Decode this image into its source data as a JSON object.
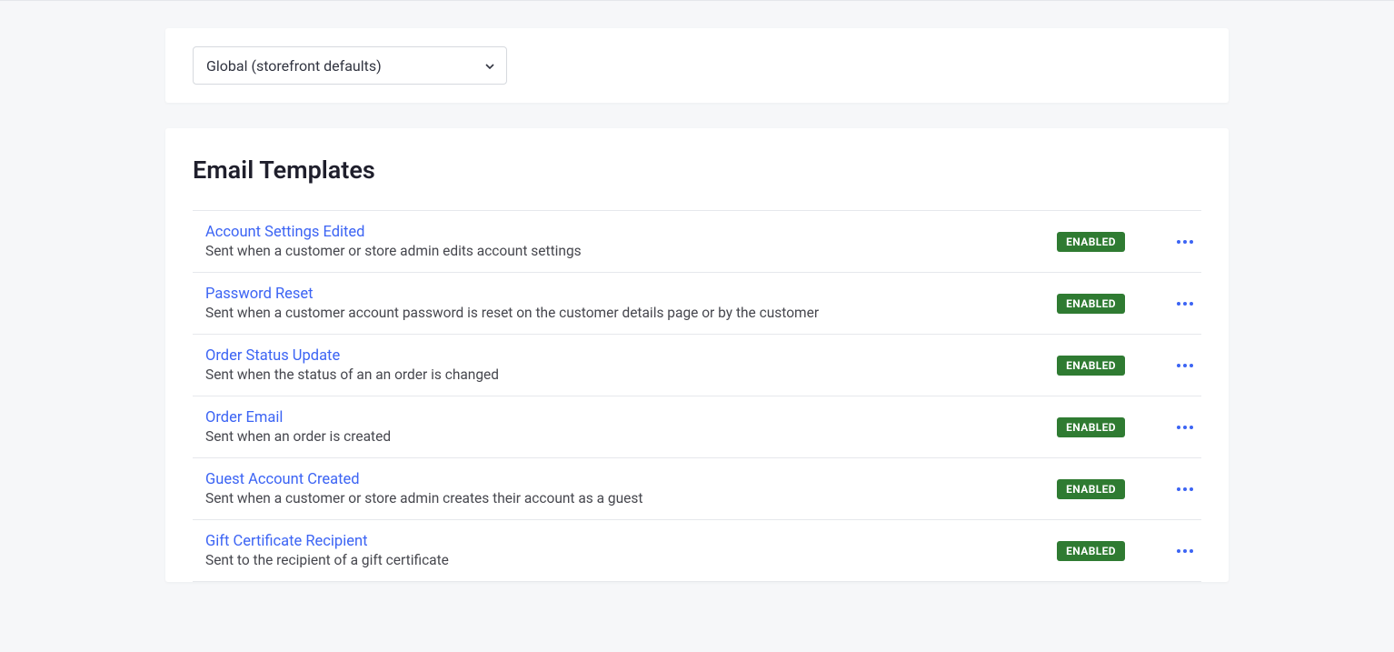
{
  "colors": {
    "link": "#3c64f4",
    "badge_bg": "#2f7b32",
    "badge_text": "#ffffff"
  },
  "selector": {
    "selected": "Global (storefront defaults)"
  },
  "section_title": "Email Templates",
  "status_label": "ENABLED",
  "templates": [
    {
      "title": "Account Settings Edited",
      "desc": "Sent when a customer or store admin edits account settings"
    },
    {
      "title": "Password Reset",
      "desc": "Sent when a customer account password is reset on the customer details page or by the customer"
    },
    {
      "title": "Order Status Update",
      "desc": "Sent when the status of an an order is changed"
    },
    {
      "title": "Order Email",
      "desc": "Sent when an order is created"
    },
    {
      "title": "Guest Account Created",
      "desc": "Sent when a customer or store admin creates their account as a guest"
    },
    {
      "title": "Gift Certificate Recipient",
      "desc": "Sent to the recipient of a gift certificate"
    }
  ]
}
